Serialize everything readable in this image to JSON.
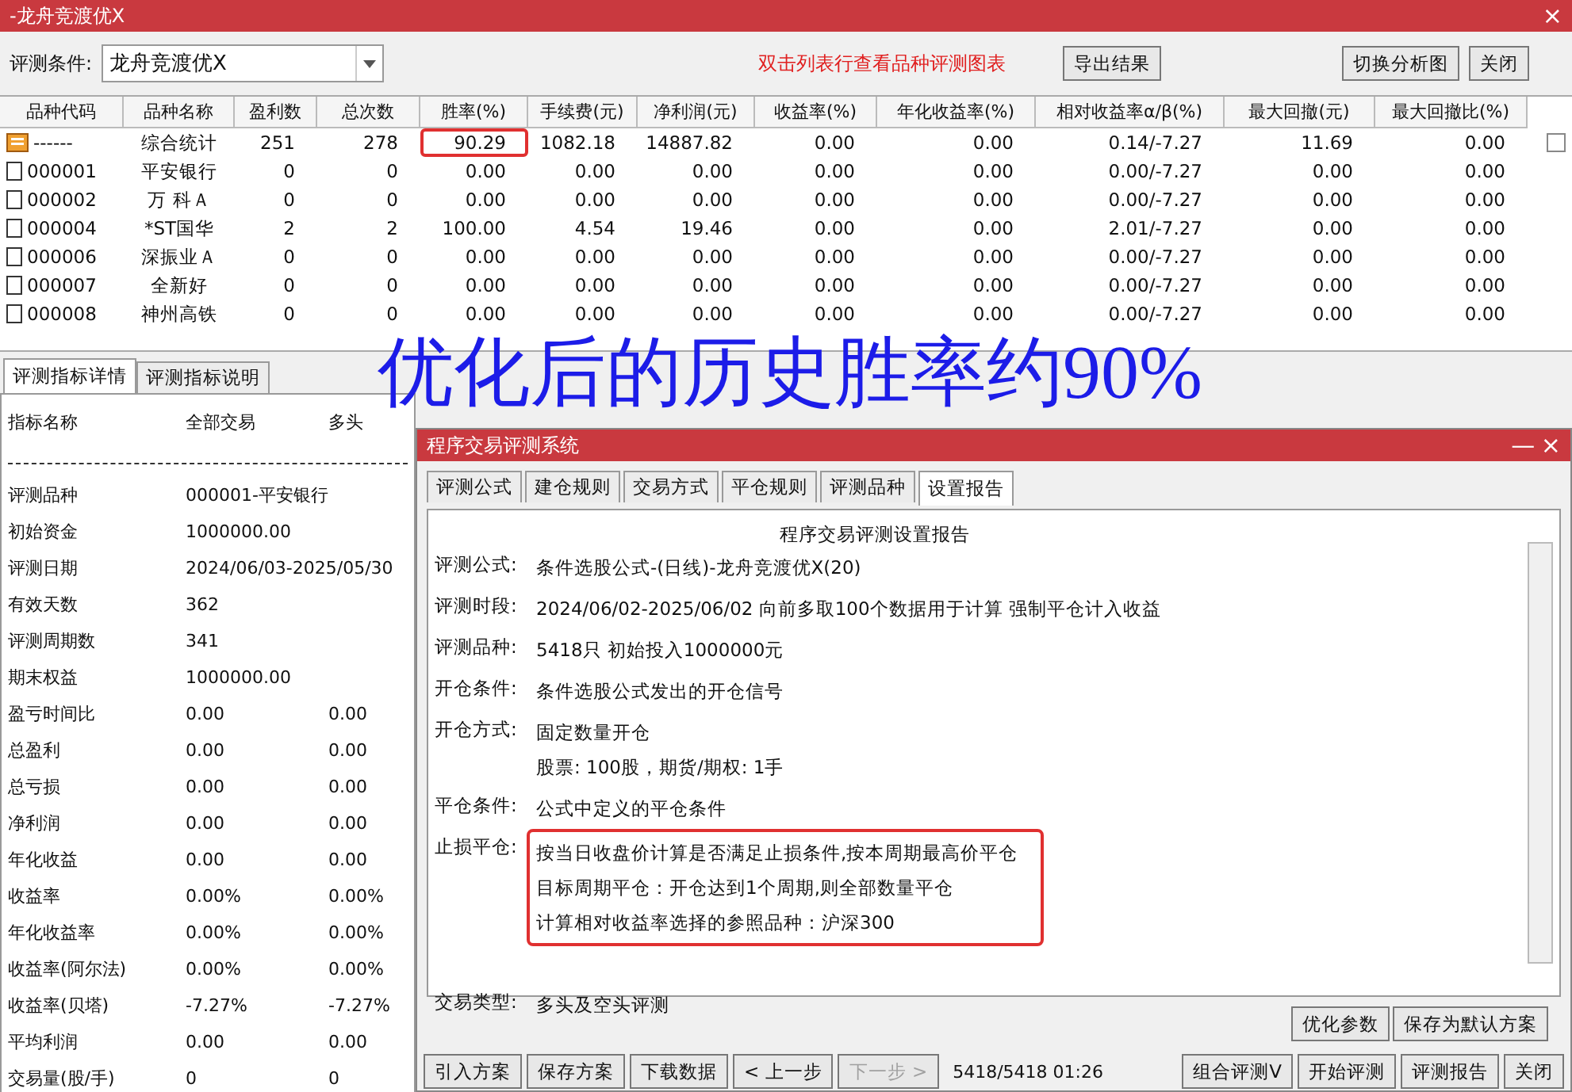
{
  "window": {
    "title": "-龙舟竞渡优X",
    "close": "×"
  },
  "toolbar": {
    "condition_label": "评测条件:",
    "condition_value": "龙舟竞渡优X",
    "hint": "双击列表行查看品种评测图表",
    "buttons": [
      "导出结果",
      "切换分析图",
      "关闭"
    ]
  },
  "table": {
    "columns": [
      "品种代码",
      "品种名称",
      "盈利数",
      "总次数",
      "胜率(%)",
      "手续费(元)",
      "净利润(元)",
      "收益率(%)",
      "年化收益率(%)",
      "相对收益率α/β(%)",
      "最大回撤(元)",
      "最大回撤比(%)"
    ],
    "rows": [
      {
        "kind": "summary",
        "cells": [
          {
            "text": "------",
            "marked": false
          },
          {
            "text": "综合统计",
            "marked": false
          },
          {
            "text": "251",
            "marked": false
          },
          {
            "text": "278",
            "marked": false
          },
          {
            "text": "90.29",
            "marked": true
          },
          {
            "text": "1082.18",
            "marked": false
          },
          {
            "text": "14887.82",
            "marked": false
          },
          {
            "text": "0.00",
            "marked": false
          },
          {
            "text": "0.00",
            "marked": false
          },
          {
            "text": "0.14/-7.27",
            "marked": false
          },
          {
            "text": "11.69",
            "marked": false
          },
          {
            "text": "0.00",
            "marked": false
          }
        ]
      },
      {
        "kind": "stock",
        "cells": [
          {
            "text": "000001",
            "marked": false
          },
          {
            "text": "平安银行",
            "marked": false
          },
          {
            "text": "0",
            "marked": false
          },
          {
            "text": "0",
            "marked": false
          },
          {
            "text": "0.00",
            "marked": false
          },
          {
            "text": "0.00",
            "marked": false
          },
          {
            "text": "0.00",
            "marked": false
          },
          {
            "text": "0.00",
            "marked": false
          },
          {
            "text": "0.00",
            "marked": false
          },
          {
            "text": "0.00/-7.27",
            "marked": false
          },
          {
            "text": "0.00",
            "marked": false
          },
          {
            "text": "0.00",
            "marked": false
          }
        ]
      },
      {
        "kind": "stock",
        "cells": [
          {
            "text": "000002",
            "marked": false
          },
          {
            "text": "万 科Ａ",
            "marked": false
          },
          {
            "text": "0",
            "marked": false
          },
          {
            "text": "0",
            "marked": false
          },
          {
            "text": "0.00",
            "marked": false
          },
          {
            "text": "0.00",
            "marked": false
          },
          {
            "text": "0.00",
            "marked": false
          },
          {
            "text": "0.00",
            "marked": false
          },
          {
            "text": "0.00",
            "marked": false
          },
          {
            "text": "0.00/-7.27",
            "marked": false
          },
          {
            "text": "0.00",
            "marked": false
          },
          {
            "text": "0.00",
            "marked": false
          }
        ]
      },
      {
        "kind": "stock",
        "cells": [
          {
            "text": "000004",
            "marked": false
          },
          {
            "text": "*ST国华",
            "marked": false
          },
          {
            "text": "2",
            "marked": false
          },
          {
            "text": "2",
            "marked": false
          },
          {
            "text": "100.00",
            "marked": false
          },
          {
            "text": "4.54",
            "marked": false
          },
          {
            "text": "19.46",
            "marked": false
          },
          {
            "text": "0.00",
            "marked": false
          },
          {
            "text": "0.00",
            "marked": false
          },
          {
            "text": "2.01/-7.27",
            "marked": false
          },
          {
            "text": "0.00",
            "marked": false
          },
          {
            "text": "0.00",
            "marked": false
          }
        ]
      },
      {
        "kind": "stock",
        "cells": [
          {
            "text": "000006",
            "marked": false
          },
          {
            "text": "深振业Ａ",
            "marked": false
          },
          {
            "text": "0",
            "marked": false
          },
          {
            "text": "0",
            "marked": false
          },
          {
            "text": "0.00",
            "marked": false
          },
          {
            "text": "0.00",
            "marked": false
          },
          {
            "text": "0.00",
            "marked": false
          },
          {
            "text": "0.00",
            "marked": false
          },
          {
            "text": "0.00",
            "marked": false
          },
          {
            "text": "0.00/-7.27",
            "marked": false
          },
          {
            "text": "0.00",
            "marked": false
          },
          {
            "text": "0.00",
            "marked": false
          }
        ]
      },
      {
        "kind": "stock",
        "cells": [
          {
            "text": "000007",
            "marked": false
          },
          {
            "text": "全新好",
            "marked": false
          },
          {
            "text": "0",
            "marked": false
          },
          {
            "text": "0",
            "marked": false
          },
          {
            "text": "0.00",
            "marked": false
          },
          {
            "text": "0.00",
            "marked": false
          },
          {
            "text": "0.00",
            "marked": false
          },
          {
            "text": "0.00",
            "marked": false
          },
          {
            "text": "0.00",
            "marked": false
          },
          {
            "text": "0.00/-7.27",
            "marked": false
          },
          {
            "text": "0.00",
            "marked": false
          },
          {
            "text": "0.00",
            "marked": false
          }
        ]
      },
      {
        "kind": "stock",
        "cells": [
          {
            "text": "000008",
            "marked": false
          },
          {
            "text": "神州高铁",
            "marked": false
          },
          {
            "text": "0",
            "marked": false
          },
          {
            "text": "0",
            "marked": false
          },
          {
            "text": "0.00",
            "marked": false
          },
          {
            "text": "0.00",
            "marked": false
          },
          {
            "text": "0.00",
            "marked": false
          },
          {
            "text": "0.00",
            "marked": false
          },
          {
            "text": "0.00",
            "marked": false
          },
          {
            "text": "0.00/-7.27",
            "marked": false
          },
          {
            "text": "0.00",
            "marked": false
          },
          {
            "text": "0.00",
            "marked": false
          }
        ]
      }
    ]
  },
  "list_checkbox": {
    "checked": false
  },
  "overlay_caption": "优化后的历史胜率约90%",
  "detail_tabs": [
    {
      "label": "评测指标详情",
      "selected": true
    },
    {
      "label": "评测指标说明",
      "selected": false
    }
  ],
  "metrics": {
    "columns": [
      "指标名称",
      "全部交易",
      "多头"
    ],
    "rows": [
      {
        "name": "评测品种",
        "values": [
          "000001-平安银行"
        ]
      },
      {
        "name": "初始资金",
        "values": [
          "1000000.00"
        ]
      },
      {
        "name": "评测日期",
        "values": [
          "2024/06/03-2025/05/30"
        ]
      },
      {
        "name": "有效天数",
        "values": [
          "362"
        ]
      },
      {
        "name": "评测周期数",
        "values": [
          "341"
        ]
      },
      {
        "name": "期末权益",
        "values": [
          "1000000.00"
        ]
      },
      {
        "name": "盈亏时间比",
        "values": [
          "0.00",
          "0.00"
        ]
      },
      {
        "name": "总盈利",
        "values": [
          "0.00",
          "0.00"
        ]
      },
      {
        "name": "总亏损",
        "values": [
          "0.00",
          "0.00"
        ]
      },
      {
        "name": "净利润",
        "values": [
          "0.00",
          "0.00"
        ]
      },
      {
        "name": "年化收益",
        "values": [
          "0.00",
          "0.00"
        ]
      },
      {
        "name": "收益率",
        "values": [
          "0.00%",
          "0.00%"
        ]
      },
      {
        "name": "年化收益率",
        "values": [
          "0.00%",
          "0.00%"
        ]
      },
      {
        "name": "收益率(阿尔法)",
        "values": [
          "0.00%",
          "0.00%"
        ]
      },
      {
        "name": "收益率(贝塔)",
        "values": [
          "-7.27%",
          "-7.27%"
        ]
      },
      {
        "name": "平均利润",
        "values": [
          "0.00",
          "0.00"
        ]
      },
      {
        "name": "交易量(股/手)",
        "values": [
          "0",
          "0"
        ]
      }
    ]
  },
  "dialog": {
    "title": "程序交易评测系统",
    "minimize": "—",
    "close": "×",
    "tabs": [
      {
        "label": "评测公式",
        "selected": false
      },
      {
        "label": "建仓规则",
        "selected": false
      },
      {
        "label": "交易方式",
        "selected": false
      },
      {
        "label": "平仓规则",
        "selected": false
      },
      {
        "label": "评测品种",
        "selected": false
      },
      {
        "label": "设置报告",
        "selected": true
      }
    ],
    "report": {
      "title": "程序交易评测设置报告",
      "items": [
        {
          "label": "评测公式:",
          "lines": [
            "条件选股公式-(日线)-龙舟竞渡优X(20)"
          ],
          "highlighted": false
        },
        {
          "label": "评测时段:",
          "lines": [
            "2024/06/02-2025/06/02 向前多取100个数据用于计算 强制平仓计入收益"
          ],
          "highlighted": false
        },
        {
          "label": "评测品种:",
          "lines": [
            "5418只 初始投入1000000元"
          ],
          "highlighted": false
        },
        {
          "label": "开仓条件:",
          "lines": [
            "条件选股公式发出的开仓信号"
          ],
          "highlighted": false
        },
        {
          "label": "开仓方式:",
          "lines": [
            "固定数量开仓",
            "股票: 100股，期货/期权: 1手"
          ],
          "highlighted": false
        },
        {
          "label": "平仓条件:",
          "lines": [
            "公式中定义的平仓条件"
          ],
          "highlighted": false
        },
        {
          "label": "止损平仓:",
          "lines": [
            "按当日收盘价计算是否满足止损条件,按本周期最高价平仓",
            "目标周期平仓：开仓达到1个周期,则全部数量平仓",
            "计算相对收益率选择的参照品种：沪深300"
          ],
          "highlighted": true
        },
        {
          "label": "交易类型:",
          "lines": [
            "多头及空头评测"
          ],
          "highlighted": false
        }
      ]
    },
    "side_buttons": [
      "优化参数",
      "保存为默认方案"
    ],
    "bottom_left": [
      {
        "label": "引入方案",
        "disabled": false
      },
      {
        "label": "保存方案",
        "disabled": false
      },
      {
        "label": "下载数据",
        "disabled": false
      },
      {
        "label": "< 上一步",
        "disabled": false
      },
      {
        "label": "下一步 >",
        "disabled": true
      }
    ],
    "progress": "5418/5418  01:26",
    "bottom_right": [
      {
        "label": "组合评测V",
        "disabled": false
      },
      {
        "label": "开始评测",
        "disabled": false
      },
      {
        "label": "评测报告",
        "disabled": false
      },
      {
        "label": "关闭",
        "disabled": false
      }
    ]
  }
}
